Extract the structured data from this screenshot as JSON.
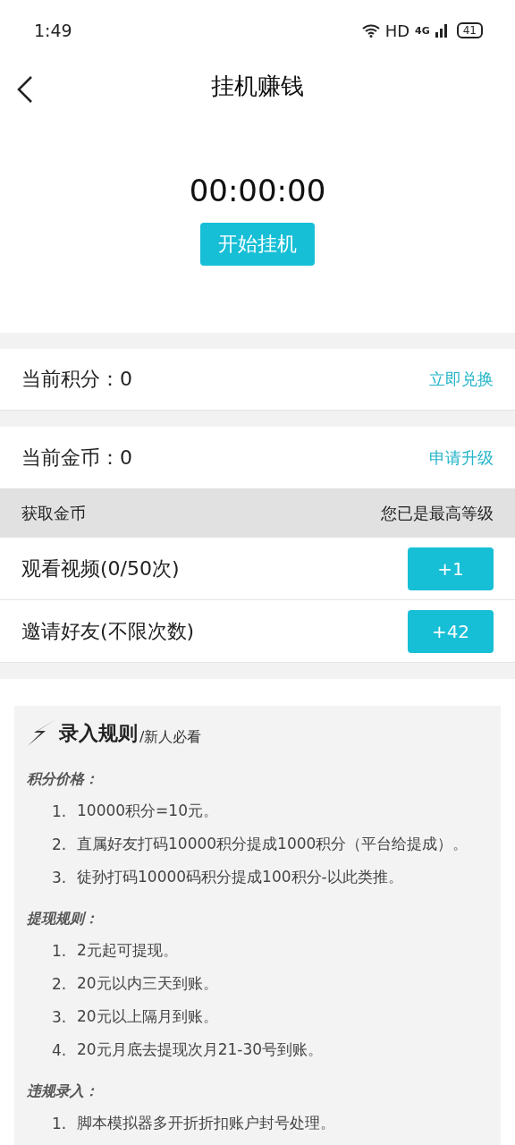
{
  "status_bar": {
    "time": "1:49",
    "hd": "HD",
    "network": "4G",
    "battery": "41"
  },
  "nav": {
    "title": "挂机赚钱"
  },
  "timer": {
    "time": "00:00:00",
    "button": "开始挂机"
  },
  "points": {
    "label": "当前积分：0",
    "action": "立即兑换"
  },
  "coins": {
    "label": "当前金币：0",
    "action": "申请升级"
  },
  "earn_header": {
    "title": "获取金币",
    "status": "您已是最高等级"
  },
  "tasks": [
    {
      "label": "观看视频(0/50次)",
      "button": "+1"
    },
    {
      "label": "邀请好友(不限次数)",
      "button": "+42"
    }
  ],
  "rules": {
    "title": "录入规则",
    "subtitle": "/新人必看",
    "sections": [
      {
        "heading": "积分价格：",
        "items": [
          {
            "number": "1.",
            "text": "10000积分=10元。"
          },
          {
            "number": "2.",
            "text": "直属好友打码10000积分提成1000积分（平台给提成）。"
          },
          {
            "number": "3.",
            "text": "徒孙打码10000码积分提成100积分-以此类推。"
          }
        ]
      },
      {
        "heading": "提现规则：",
        "items": [
          {
            "number": "1.",
            "text": "2元起可提现。"
          },
          {
            "number": "2.",
            "text": "20元以内三天到账。"
          },
          {
            "number": "3.",
            "text": "20元以上隔月到账。"
          },
          {
            "number": "4.",
            "text": "20元月底去提现次月21-30号到账。"
          }
        ]
      },
      {
        "heading": "违规录入：",
        "items": [
          {
            "number": "1.",
            "text": "脚本模拟器多开折折扣账户封号处理。"
          }
        ]
      }
    ]
  }
}
